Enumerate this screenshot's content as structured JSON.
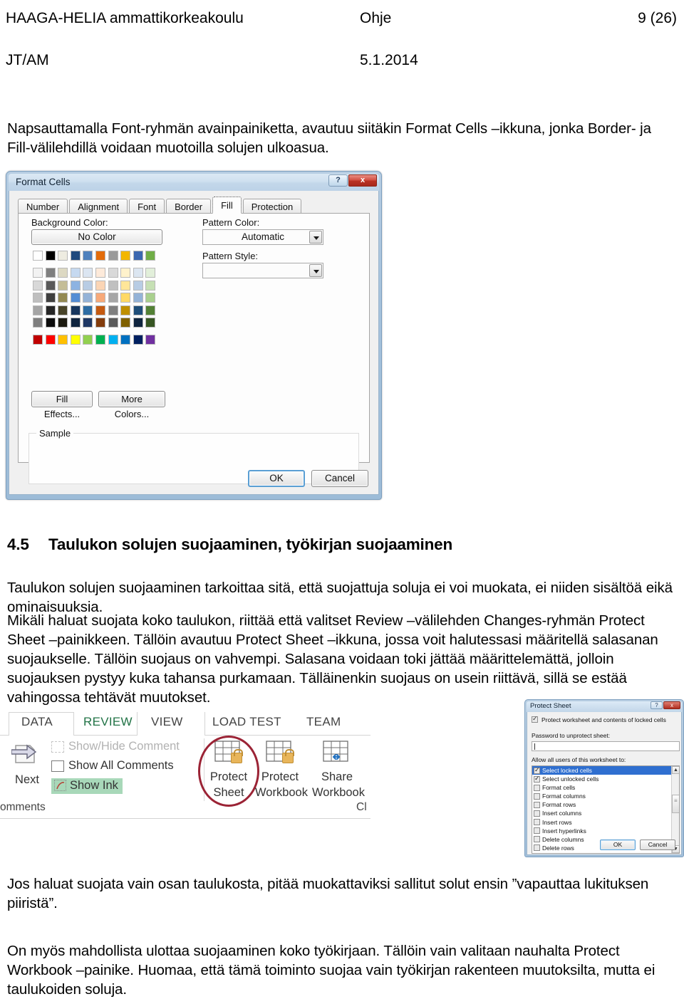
{
  "header": {
    "organization": "HAAGA-HELIA ammattikorkeakoulu",
    "doc_type": "Ohje",
    "page_number": "9 (26)",
    "author_code": "JT/AM",
    "date": "5.1.2014"
  },
  "intro_paragraph": "Napsauttamalla Font-ryhmän avainpainiketta, avautuu siitäkin Format Cells –ikkuna, jonka Border- ja Fill-välilehdillä voidaan muotoilla solujen ulkoasua.",
  "format_cells_dialog": {
    "title": "Format Cells",
    "help_button": "?",
    "close_button": "x",
    "tabs": [
      {
        "label": "Number",
        "active": false
      },
      {
        "label": "Alignment",
        "active": false
      },
      {
        "label": "Font",
        "active": false
      },
      {
        "label": "Border",
        "active": false
      },
      {
        "label": "Fill",
        "active": true
      },
      {
        "label": "Protection",
        "active": false
      }
    ],
    "background_color_label": "Background Color:",
    "no_color_button": "No Color",
    "pattern_color_label": "Pattern Color:",
    "pattern_color_value": "Automatic",
    "pattern_style_label": "Pattern Style:",
    "pattern_style_value": "",
    "fill_effects_button": "Fill Effects...",
    "more_colors_button": "More Colors...",
    "sample_label": "Sample",
    "ok_button": "OK",
    "cancel_button": "Cancel",
    "palette": {
      "theme_row": [
        "#ffffff",
        "#000000",
        "#eeece1",
        "#1f497d",
        "#4f81bd",
        "#e36c0a",
        "#9a9a9a",
        "#f2b600",
        "#3b67b0",
        "#70ad47"
      ],
      "tint_rows": [
        [
          "#f2f2f2",
          "#7f7f7f",
          "#ddd9c3",
          "#c6d9f0",
          "#dbe5f1",
          "#fdeada",
          "#d9d9d9",
          "#fff2cc",
          "#dce6f1",
          "#e2efda"
        ],
        [
          "#d8d8d8",
          "#595959",
          "#c4bd97",
          "#8db3e2",
          "#b8cce4",
          "#fbd5b5",
          "#c0c0c0",
          "#ffe699",
          "#b8cce4",
          "#c6e0b4"
        ],
        [
          "#bfbfbf",
          "#3f3f3f",
          "#938953",
          "#548dd4",
          "#95b3d7",
          "#f7a979",
          "#a6a6a6",
          "#ffd966",
          "#95b3d7",
          "#a9d08e"
        ],
        [
          "#a5a5a5",
          "#262626",
          "#494429",
          "#17365d",
          "#2e6da4",
          "#c55a11",
          "#7f7f7f",
          "#bf8f00",
          "#1f4e79",
          "#538135"
        ],
        [
          "#7f7f7f",
          "#0c0c0c",
          "#1d1b10",
          "#0f243e",
          "#1f3864",
          "#833c0c",
          "#5a5a5a",
          "#7f6000",
          "#10253f",
          "#375623"
        ]
      ],
      "standard_row": [
        "#c00000",
        "#ff0000",
        "#ffc000",
        "#ffff00",
        "#92d050",
        "#00b050",
        "#00b0f0",
        "#0070c0",
        "#002060",
        "#7030a0"
      ]
    }
  },
  "section": {
    "number": "4.5",
    "title": "Taulukon solujen suojaaminen, työkirjan suojaaminen"
  },
  "body_paragraphs": [
    "Taulukon solujen suojaaminen tarkoittaa sitä, että suojattuja soluja ei voi muokata, ei niiden sisältöä eikä ominaisuuksia.",
    "Mikäli haluat suojata koko taulukon, riittää että valitset Review –välilehden Changes-ryhmän Protect Sheet –painikkeen. Tällöin avautuu Protect Sheet –ikkuna, jossa voit halutessasi määritellä salasanan suojaukselle. Tällöin suojaus on vahvempi. Salasana voidaan toki jättää määrittelemättä, jolloin suojauksen pystyy kuka tahansa purkamaan. Tälläinenkin suojaus on usein riittävä, sillä se estää vahingossa tehtävät muutokset.",
    "Jos haluat suojata vain osan taulukosta, pitää muokattaviksi sallitut solut ensin ”vapauttaa lukituksen piiristä”.",
    "On myös mahdollista ulottaa suojaaminen koko työkirjaan. Tällöin vain valitaan nauhalta Protect Workbook –painike. Huomaa, että tämä toiminto suojaa vain työkirjan rakenteen muutoksilta, mutta ei taulukoiden soluja."
  ],
  "ribbon": {
    "tabs": [
      {
        "label": "DATA",
        "active": false
      },
      {
        "label": "REVIEW",
        "active": true
      },
      {
        "label": "VIEW",
        "active": false
      },
      {
        "label": "LOAD TEST",
        "active": false
      },
      {
        "label": "TEAM",
        "active": false
      }
    ],
    "active_tab_color": "#217346",
    "next_button": "Next",
    "comments_group_label": "omments",
    "changes_group_label": "Cl",
    "items": [
      {
        "label": "Show/Hide Comment",
        "state": "disabled"
      },
      {
        "label": "Show All Comments",
        "state": "normal"
      },
      {
        "label": "Show Ink",
        "state": "highlighted"
      }
    ],
    "highlight_color": "#a8d8b9",
    "buttons": [
      {
        "line1": "Protect",
        "line2": "Sheet",
        "annotated": true
      },
      {
        "line1": "Protect",
        "line2": "Workbook",
        "annotated": false
      },
      {
        "line1": "Share",
        "line2": "Workbook",
        "annotated": false
      }
    ],
    "annotation_color": "#9b2335"
  },
  "protect_sheet_dialog": {
    "title": "Protect Sheet",
    "help_button": "?",
    "close_button": "x",
    "protect_checkbox": {
      "label": "Protect worksheet and contents of locked cells",
      "checked": true
    },
    "password_label": "Password to unprotect sheet:",
    "password_value": "",
    "allow_label": "Allow all users of this worksheet to:",
    "permissions": [
      {
        "label": "Select locked cells",
        "checked": true,
        "selected": true
      },
      {
        "label": "Select unlocked cells",
        "checked": true,
        "selected": false
      },
      {
        "label": "Format cells",
        "checked": false,
        "selected": false
      },
      {
        "label": "Format columns",
        "checked": false,
        "selected": false
      },
      {
        "label": "Format rows",
        "checked": false,
        "selected": false
      },
      {
        "label": "Insert columns",
        "checked": false,
        "selected": false
      },
      {
        "label": "Insert rows",
        "checked": false,
        "selected": false
      },
      {
        "label": "Insert hyperlinks",
        "checked": false,
        "selected": false
      },
      {
        "label": "Delete columns",
        "checked": false,
        "selected": false
      },
      {
        "label": "Delete rows",
        "checked": false,
        "selected": false
      }
    ],
    "scroll_up": "▲",
    "scroll_down": "▼",
    "ok_button": "OK",
    "cancel_button": "Cancel"
  }
}
